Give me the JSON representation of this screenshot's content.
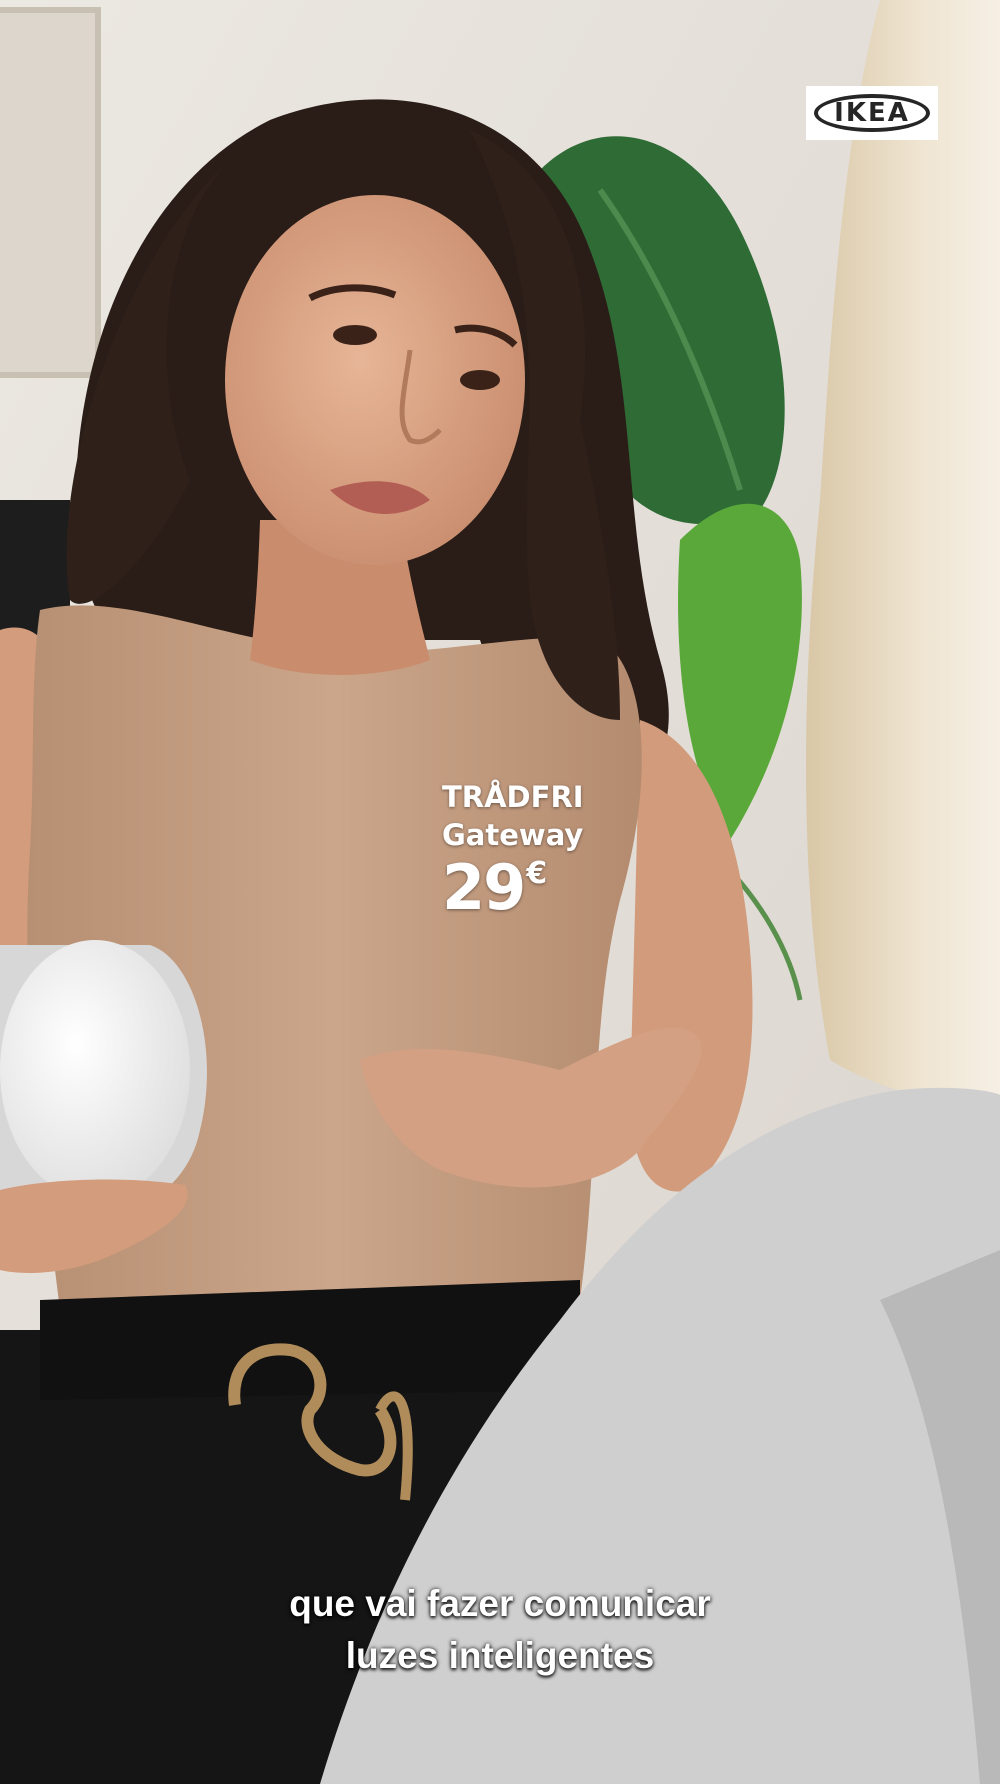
{
  "brand": {
    "logo_text": "IKEA",
    "logo_color": "#262626",
    "logo_background": "#ffffff"
  },
  "product": {
    "name": "TRÅDFRI",
    "subtitle": "Gateway",
    "price": "29",
    "currency": "€"
  },
  "subtitles": {
    "line1": "que vai fazer comunicar",
    "line2": "luzes inteligentes"
  },
  "colors": {
    "top_color": "#c8a287",
    "skin": "#d9a383",
    "hair": "#2a1d17",
    "plant": "#2f7a3a",
    "gray_sweater": "#cfcfcf",
    "blonde_hair": "#e8dcc4",
    "wall": "#e6e1db",
    "pants": "#151515"
  }
}
